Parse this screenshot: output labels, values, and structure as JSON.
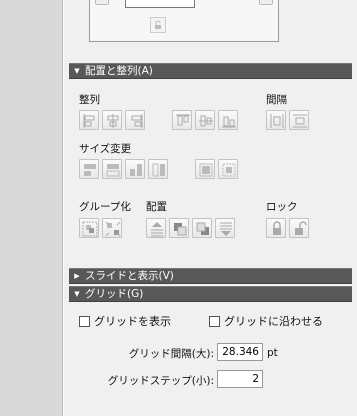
{
  "arrange": {
    "header": "配置と整列(A)",
    "align_label": "整列",
    "spacing_label": "間隔",
    "resize_label": "サイズ変更",
    "group_label": "グループ化",
    "placement_label": "配置",
    "lock_label": "ロック"
  },
  "slides_section": {
    "header": "スライドと表示(V)"
  },
  "grid": {
    "header": "グリッド(G)",
    "show_grid": "グリッドを表示",
    "snap_to_grid": "グリッドに沿わせる",
    "spacing_label": "グリッド間隔(大):",
    "spacing_value": "28.346",
    "spacing_unit": "pt",
    "step_label": "グリッドステップ(小):",
    "step_value": "2"
  }
}
